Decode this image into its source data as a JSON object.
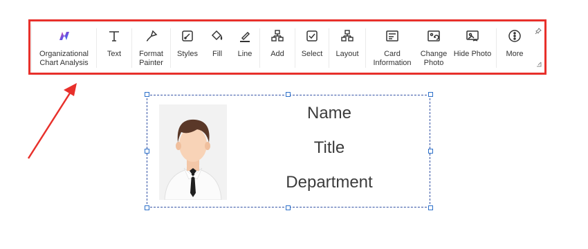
{
  "toolbar": {
    "buttons": [
      {
        "label": "Organizational\nChart Analysis",
        "icon": "org-chart-analysis-icon"
      },
      {
        "label": "Text",
        "icon": "text-icon"
      },
      {
        "label": "Format\nPainter",
        "icon": "format-painter-icon"
      },
      {
        "label": "Styles",
        "icon": "styles-icon"
      },
      {
        "label": "Fill",
        "icon": "fill-bucket-icon"
      },
      {
        "label": "Line",
        "icon": "line-pen-icon"
      },
      {
        "label": "Add",
        "icon": "add-node-icon"
      },
      {
        "label": "Select",
        "icon": "select-checkbox-icon"
      },
      {
        "label": "Layout",
        "icon": "layout-tree-icon"
      },
      {
        "label": "Card\nInformation",
        "icon": "card-information-icon"
      },
      {
        "label": "Change\nPhoto",
        "icon": "change-photo-icon"
      },
      {
        "label": "Hide Photo",
        "icon": "hide-photo-icon"
      },
      {
        "label": "More",
        "icon": "more-circle-icon"
      }
    ],
    "pin_icon": "pin-icon",
    "expand_icon": "expand-corner-icon",
    "highlight_color": "#e8302b"
  },
  "card": {
    "name": "Name",
    "title": "Title",
    "department": "Department",
    "border_color": "#2f4fa3"
  }
}
